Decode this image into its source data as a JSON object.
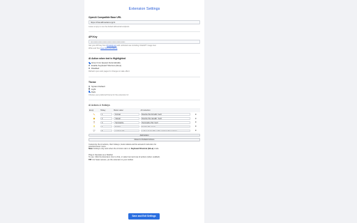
{
  "page": {
    "title": "Extension Settings"
  },
  "base_url": {
    "label": "OpenAI Compatible Base URL",
    "value": "https://chat.alltmatrad.org/v1",
    "hint": "Leave empty to use the default alltmatrad endpoint."
  },
  "api_key": {
    "label": "API Key",
    "value": "••••••••••••••••••••••••••••••••••••••••••",
    "hint_pre": "Get your API key from ",
    "hint_link": "llmstudy.org",
    "hint_post": " with unlimited use including ChatGPT image Gen",
    "hint2_pre": "Write and Text ",
    "hint2_link": "(see Documentation)"
  },
  "ai_action": {
    "label": "AI Action when text is Highlighted",
    "options": [
      {
        "label": "Hover Icon Appear Automatically",
        "selected": true
      },
      {
        "label": "Enable Keyboard Shortcut (Alt+a)",
        "selected": false
      },
      {
        "label": "Disabled",
        "selected": false
      }
    ],
    "hint": "Refresh open web pages for changes to take effect."
  },
  "theme": {
    "label": "Theme",
    "options": [
      {
        "label": "System Default",
        "selected": false
      },
      {
        "label": "Light",
        "selected": false
      },
      {
        "label": "Dark",
        "selected": true
      }
    ],
    "hint": "Choose your preferred theme for the extension UI."
  },
  "actions_table": {
    "label": "AI Actions & Hotkeys",
    "headers": [
      "Emoji",
      "Hotkey",
      "Button Label",
      "AI Instruction"
    ],
    "rows": [
      {
        "emoji": "✏️",
        "hotkey": "1",
        "label": "Format",
        "instruction": "Rewrite this formally: {text}"
      },
      {
        "emoji": "😊",
        "hotkey": "2",
        "label": "Casual",
        "instruction": "Rewrite this casually: {text}"
      },
      {
        "emoji": "📋",
        "hotkey": "3",
        "label": "Summarize",
        "instruction": "Summarize this: {text}"
      },
      {
        "emoji": "💡",
        "hotkey": "4",
        "label": "Explain",
        "instruction": "Explain this: {text}"
      },
      {
        "emoji": "💬",
        "hotkey": "5",
        "label": "social media",
        "instruction": "reply to {text} with a witty social media response"
      }
    ],
    "add_label": "Add Action",
    "reset_label": "Reset to Default Actions"
  },
  "description": {
    "line1": "Customize the AI actions, their hotkeys, button labels and the actual AI instruction for",
    "line2": "selection/hover menu.",
    "note_bold": "Note:",
    "note_text": " Hotkeys only work when the AI Action tab is in ",
    "note_bold2": "Keyboard Shortcut (Alt+a)",
    "note_end": " mode."
  },
  "sidebar_info": {
    "line1": "Plug-in Operates as a Sidebar",
    "line2": "To use: Click the Extension Icon to chat, or select text and use AI actions (when enabled).",
    "tip_bold": "TIP:",
    "tip_text": " For faster access, pin the extension to your toolbar."
  },
  "save_button": {
    "label": "Save and Exit Settings"
  },
  "colors": {
    "accent": "#2b6fe0",
    "delete": "#d0352b",
    "background": "#f1f2f5"
  },
  "icons": {
    "delete": "close-x-icon",
    "radio": "radio-icon"
  }
}
